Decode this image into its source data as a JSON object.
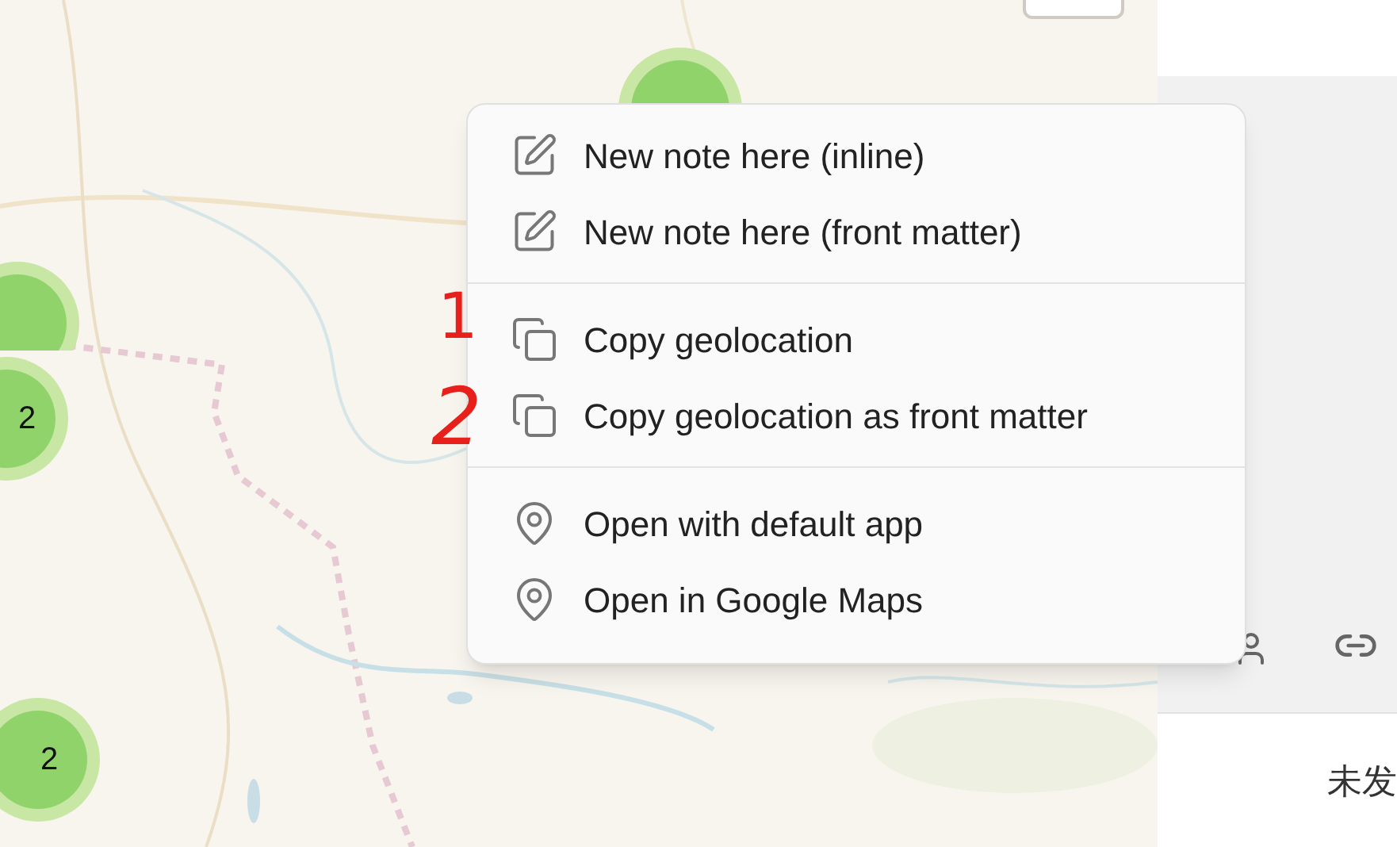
{
  "map": {
    "clusters": [
      {
        "count": "2"
      },
      {
        "count": "2"
      }
    ]
  },
  "context_menu": {
    "groups": [
      {
        "kind": "new",
        "items": [
          {
            "label": "New note here (inline)"
          },
          {
            "label": "New note here (front matter)"
          }
        ]
      },
      {
        "kind": "copy",
        "items": [
          {
            "label": "Copy geolocation"
          },
          {
            "label": "Copy geolocation as front matter"
          }
        ]
      },
      {
        "kind": "open",
        "items": [
          {
            "label": "Open with default app"
          },
          {
            "label": "Open in Google Maps"
          }
        ]
      }
    ]
  },
  "annotations": [
    "1",
    "2"
  ],
  "side_panel": {
    "text": "未发"
  }
}
